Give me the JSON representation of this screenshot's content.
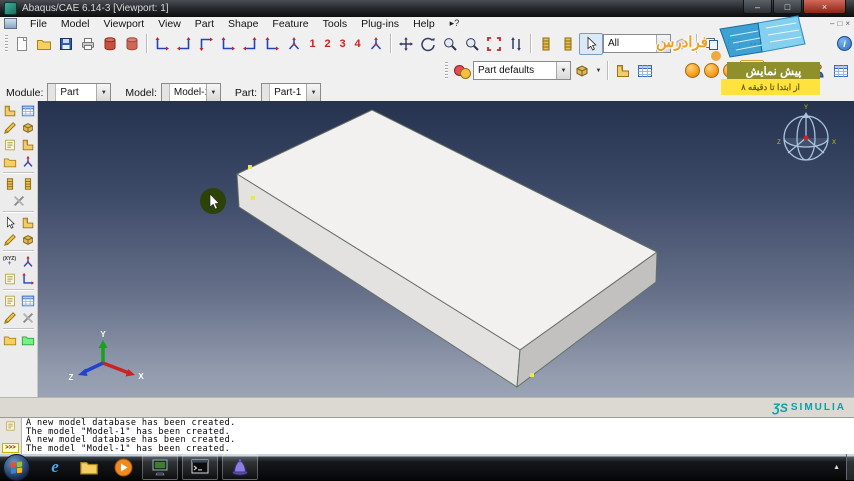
{
  "window": {
    "title": "Abaqus/CAE 6.14-3 [Viewport: 1]"
  },
  "icons": {
    "dropdown": "▼",
    "minimize": "–",
    "maximize": "□",
    "close": "×",
    "info": "i",
    "up_arrow": "▲",
    "context_help": "▸?",
    "play": "▶"
  },
  "menubar": {
    "items": [
      "File",
      "Model",
      "Viewport",
      "View",
      "Part",
      "Shape",
      "Feature",
      "Tools",
      "Plug-ins",
      "Help"
    ]
  },
  "toolbars": {
    "viewport_numbers": [
      "1",
      "2",
      "3",
      "4"
    ],
    "selection_scope": "All",
    "display_defaults": "Part defaults"
  },
  "contextbar": {
    "module_label": "Module:",
    "module_value": "Part",
    "model_label": "Model:",
    "model_value": "Model-1",
    "part_label": "Part:",
    "part_value": "Part-1"
  },
  "toolbox": {
    "xyz_label": "(XYZ)",
    "xyz_plus": "+"
  },
  "viewport": {
    "triad": {
      "x": "X",
      "y": "Y",
      "z": "Z"
    },
    "compass": {
      "x": "X",
      "y": "Y",
      "z": "Z"
    },
    "brand_glyph": "ƷS",
    "brand_text": "SIMULIA"
  },
  "messages": {
    "cli_label": ">>>",
    "lines": [
      "A new model database has been created.",
      "The model \"Model-1\" has been created.",
      "A new model database has been created.",
      "The model \"Model-1\" has been created."
    ]
  },
  "overlay": {
    "brand": "فرادرس",
    "preview_title": "پیش نمایش",
    "preview_subtitle": "از ابتدا تا دقیقه ۸"
  },
  "colors": {
    "viewport_top": "#26334f",
    "viewport_bottom": "#9aa3b3",
    "part_top": "#f2f1ef",
    "part_front": "#e3e2e0",
    "part_right": "#c2c1bf",
    "accent_red": "#cc2222",
    "simulia_teal": "#00a5a8",
    "overlay_olive": "#8f8f2c",
    "overlay_yellow": "#ffe23e"
  }
}
